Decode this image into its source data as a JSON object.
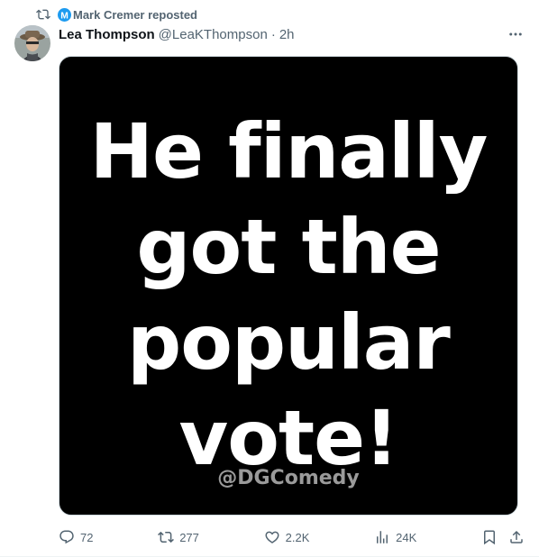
{
  "repost": {
    "text": "Mark Cremer reposted",
    "icon": "repost-icon",
    "badge_color": "#1d9bf0"
  },
  "author": {
    "display_name": "Lea Thompson",
    "handle": "@LeaKThompson",
    "separator": "·",
    "time": "2h"
  },
  "media": {
    "lines": [
      "He finally",
      "got the",
      "popular",
      "vote!"
    ],
    "watermark": "@DGComedy",
    "background": "#000000",
    "text_color": "#ffffff"
  },
  "actions": {
    "replies": "72",
    "reposts": "277",
    "likes": "2.2K",
    "views": "24K"
  },
  "colors": {
    "muted": "#536471",
    "text": "#0f1419"
  }
}
